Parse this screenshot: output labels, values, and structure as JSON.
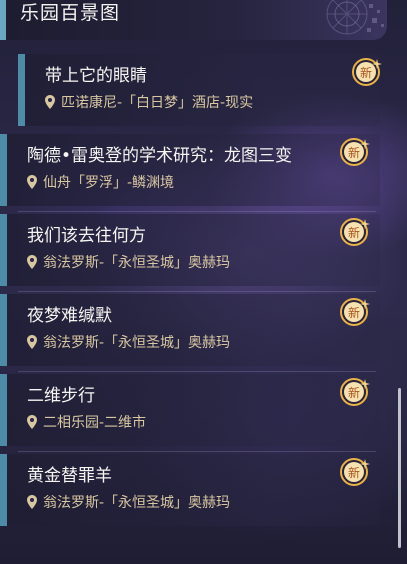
{
  "header": {
    "title": "乐园百景图"
  },
  "badge_text": "新",
  "colors": {
    "accent_bar": "#4e8ba6",
    "location_text": "#d9c7a2",
    "badge_gold": "#e8b24a"
  },
  "items": [
    {
      "title": "带上它的眼睛",
      "location": "匹诺康尼-「白日梦」酒店-现实"
    },
    {
      "title": "陶德•雷奥登的学术研究：龙图三变",
      "location": "仙舟「罗浮」-鳞渊境"
    },
    {
      "title": "我们该去往何方",
      "location": "翁法罗斯-「永恒圣城」奥赫玛"
    },
    {
      "title": "夜梦难缄默",
      "location": "翁法罗斯-「永恒圣城」奥赫玛"
    },
    {
      "title": "二维步行",
      "location": "二相乐园-二维市"
    },
    {
      "title": "黄金替罪羊",
      "location": "翁法罗斯-「永恒圣城」奥赫玛"
    }
  ]
}
